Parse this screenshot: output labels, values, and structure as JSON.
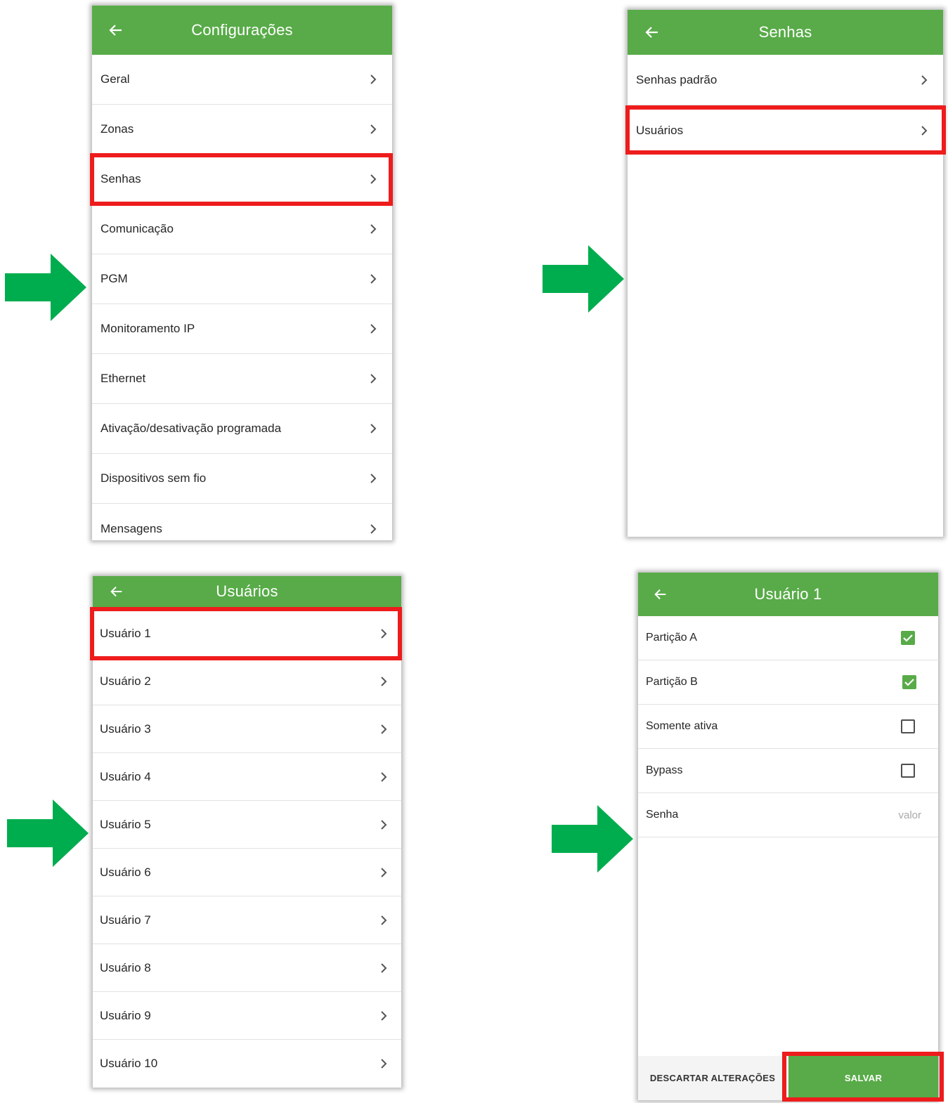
{
  "colors": {
    "appbar": "#58ab48",
    "highlight": "#ee1c1c",
    "arrow": "#00ad4e"
  },
  "icons": {
    "back": "arrow-left-icon",
    "chevron": "chevron-right-icon",
    "arrow": "green-right-arrow"
  },
  "config_screen": {
    "title": "Configurações",
    "items": [
      {
        "label": "Geral"
      },
      {
        "label": "Zonas"
      },
      {
        "label": "Senhas"
      },
      {
        "label": "Comunicação"
      },
      {
        "label": "PGM"
      },
      {
        "label": "Monitoramento IP"
      },
      {
        "label": "Ethernet"
      },
      {
        "label": "Ativação/desativação programada"
      },
      {
        "label": "Dispositivos sem fio"
      },
      {
        "label": "Mensagens"
      }
    ]
  },
  "senhas_screen": {
    "title": "Senhas",
    "items": [
      {
        "label": "Senhas padrão"
      },
      {
        "label": "Usuários"
      }
    ]
  },
  "usuarios_screen": {
    "title": "Usuários",
    "items": [
      {
        "label": "Usuário 1"
      },
      {
        "label": "Usuário 2"
      },
      {
        "label": "Usuário 3"
      },
      {
        "label": "Usuário 4"
      },
      {
        "label": "Usuário 5"
      },
      {
        "label": "Usuário 6"
      },
      {
        "label": "Usuário 7"
      },
      {
        "label": "Usuário 8"
      },
      {
        "label": "Usuário 9"
      },
      {
        "label": "Usuário 10"
      }
    ]
  },
  "usuario1_screen": {
    "title": "Usuário 1",
    "items": [
      {
        "label": "Partição A",
        "checked": true
      },
      {
        "label": "Partição B",
        "checked": true
      },
      {
        "label": "Somente ativa",
        "checked": false
      },
      {
        "label": "Bypass",
        "checked": false
      }
    ],
    "password": {
      "label": "Senha",
      "placeholder": "valor"
    },
    "discard_label": "DESCARTAR ALTERAÇÕES",
    "save_label": "SALVAR"
  }
}
